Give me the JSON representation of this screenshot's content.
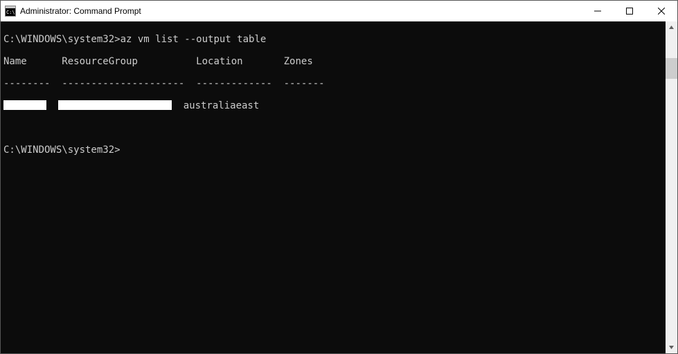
{
  "window": {
    "title": "Administrator: Command Prompt"
  },
  "terminal": {
    "prompt1": "C:\\WINDOWS\\system32>",
    "command1": "az vm list --output table",
    "header": {
      "name": "Name",
      "resourceGroup": "ResourceGroup",
      "location": "Location",
      "zones": "Zones"
    },
    "sep": {
      "name": "--------",
      "resourceGroup": "---------------------",
      "location": "-------------",
      "zones": "-------"
    },
    "row1": {
      "location": "australiaeast"
    },
    "prompt2": "C:\\WINDOWS\\system32>"
  }
}
